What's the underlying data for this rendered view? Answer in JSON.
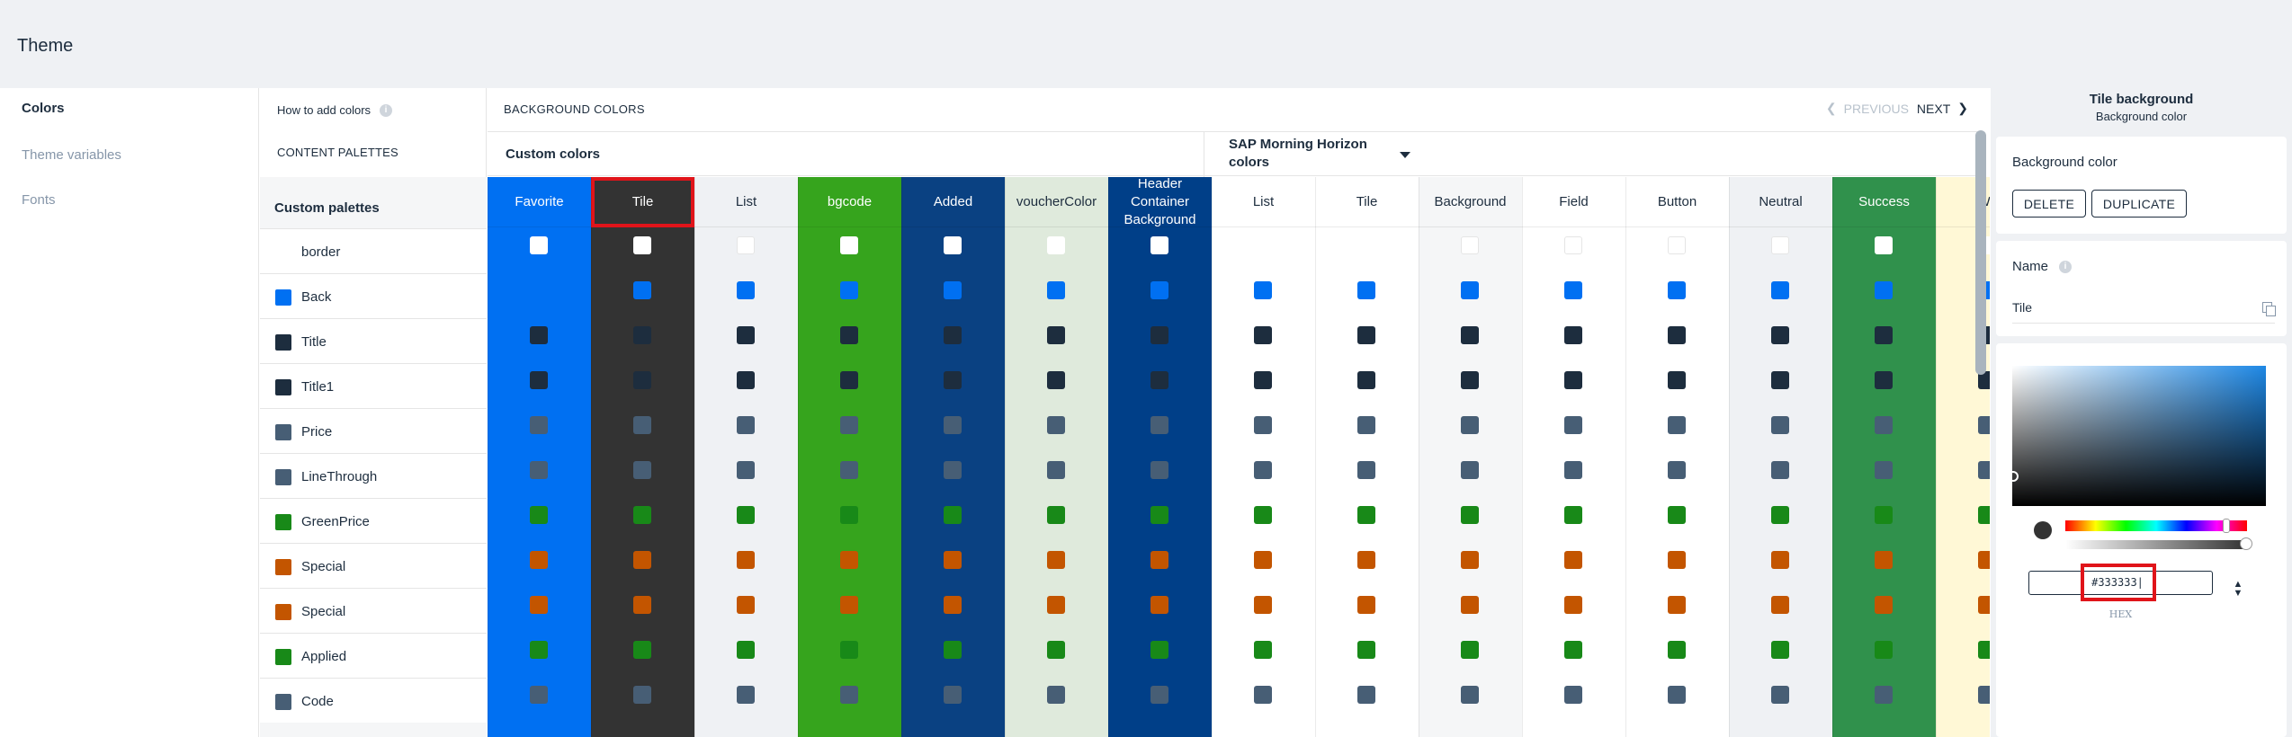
{
  "app": {
    "title": "Theme"
  },
  "leftnav": {
    "items": [
      {
        "label": "Colors",
        "active": true
      },
      {
        "label": "Theme variables",
        "active": false
      },
      {
        "label": "Fonts",
        "active": false
      }
    ]
  },
  "palettes": {
    "how_to": "How to add colors",
    "content_palettes": "CONTENT PALETTES",
    "custom_palettes": "Custom palettes",
    "rows": [
      {
        "label": "border",
        "color": ""
      },
      {
        "label": "Back",
        "color": "#0070f2"
      },
      {
        "label": "Title",
        "color": "#1d2d3e"
      },
      {
        "label": "Title1",
        "color": "#1d2d3e"
      },
      {
        "label": "Price",
        "color": "#475e75"
      },
      {
        "label": "LineThrough",
        "color": "#475e75"
      },
      {
        "label": "GreenPrice",
        "color": "#188918"
      },
      {
        "label": "Special",
        "color": "#c35500"
      },
      {
        "label": "Special",
        "color": "#c35500"
      },
      {
        "label": "Applied",
        "color": "#188918"
      },
      {
        "label": "Code",
        "color": "#475e75"
      }
    ]
  },
  "main": {
    "section_title": "BACKGROUND COLORS",
    "previous_label": "PREVIOUS",
    "next_label": "NEXT",
    "group_custom": "Custom colors",
    "group_sap": "SAP Morning Horizon colors",
    "columns": [
      {
        "label": "Favorite",
        "bg": "#0070f2",
        "fg": "#ffffff"
      },
      {
        "label": "Tile",
        "bg": "#333333",
        "fg": "#ffffff",
        "selected": true
      },
      {
        "label": "List",
        "bg": "#eff1f4",
        "fg": "#1d2d3e"
      },
      {
        "label": "bgcode",
        "bg": "#36a41d",
        "fg": "#ffffff"
      },
      {
        "label": "Added",
        "bg": "#0a4182",
        "fg": "#ffffff"
      },
      {
        "label": "voucherColor",
        "bg": "#dfeadc",
        "fg": "#1d2d3e"
      },
      {
        "label": "Header Container Background",
        "bg": "#003f88",
        "fg": "#ffffff"
      },
      {
        "label": "List",
        "bg": "#ffffff",
        "fg": "#1d2d3e"
      },
      {
        "label": "Tile",
        "bg": "#ffffff",
        "fg": "#1d2d3e"
      },
      {
        "label": "Background",
        "bg": "#f5f6f7",
        "fg": "#1d2d3e"
      },
      {
        "label": "Field",
        "bg": "#ffffff",
        "fg": "#1d2d3e"
      },
      {
        "label": "Button",
        "bg": "#ffffff",
        "fg": "#1d2d3e"
      },
      {
        "label": "Neutral",
        "bg": "#eff1f4",
        "fg": "#1d2d3e"
      },
      {
        "label": "Success",
        "bg": "#30914c",
        "fg": "#ffffff"
      },
      {
        "label": "Wa",
        "bg": "#fff8d6",
        "fg": "#1d2d3e"
      }
    ]
  },
  "right": {
    "title": "Tile background",
    "subtitle": "Background color",
    "card_label": "Background color",
    "delete_label": "DELETE",
    "duplicate_label": "DUPLICATE",
    "name_label": "Name",
    "name_value": "Tile",
    "hex_value": "#333333|",
    "hex_label": "HEX",
    "current_color": "#333333"
  },
  "colors": {
    "accent": "#0070f2",
    "highlight": "#e0141a"
  }
}
